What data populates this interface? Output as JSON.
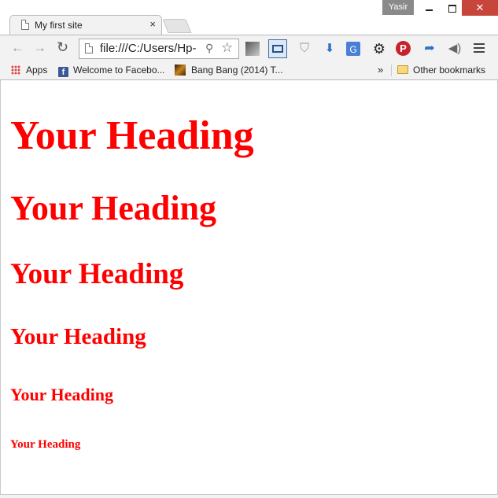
{
  "window": {
    "user_name": "Yasir",
    "minimize_label": "",
    "maximize_label": "",
    "close_label": "✕"
  },
  "tab": {
    "title": "My first site",
    "close_label": "×"
  },
  "toolbar": {
    "back_label": "←",
    "forward_label": "→",
    "reload_label": "↻",
    "url": "file:///C:/Users/Hp-",
    "zoom_icon": "search-icon",
    "star_icon": "star-icon"
  },
  "bookmarks": {
    "apps_label": "Apps",
    "items": [
      {
        "label": "Welcome to Facebo..."
      },
      {
        "label": "Bang Bang (2014) T..."
      }
    ],
    "more_label": "»",
    "other_label": "Other bookmarks"
  },
  "page": {
    "headings": [
      {
        "level": "h1",
        "text": "Your Heading"
      },
      {
        "level": "h2",
        "text": "Your Heading"
      },
      {
        "level": "h3",
        "text": "Your Heading"
      },
      {
        "level": "h4",
        "text": "Your Heading"
      },
      {
        "level": "h5",
        "text": "Your Heading"
      },
      {
        "level": "h6",
        "text": "Your Heading"
      }
    ],
    "heading_color": "#ff0000"
  },
  "colors": {
    "close_button": "#c7453b",
    "chrome_gray": "#f2f2f2"
  }
}
